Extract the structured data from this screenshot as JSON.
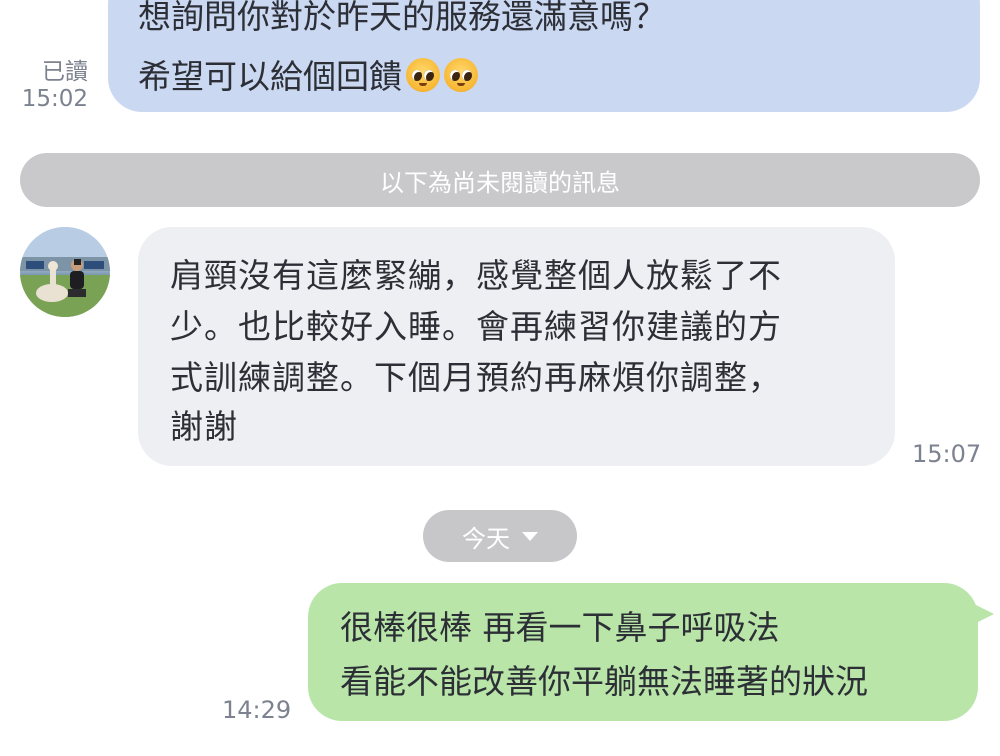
{
  "top_message": {
    "lines": [
      "想詢問你對於昨天的服務還滿意嗎？",
      "希望可以給個回饋"
    ],
    "emojis": [
      "pleading-face-emoji",
      "pleading-face-emoji"
    ],
    "read_label": "已讀",
    "time": "15:02"
  },
  "unread_divider": "以下為尚未閱讀的訊息",
  "incoming_message": {
    "lines": [
      "肩頸沒有這麼緊繃，感覺整個人放鬆了不",
      "少。也比較好入睡。會再練習你建議的方",
      "式訓練調整。下個月預約再麻煩你調整，",
      "謝謝"
    ],
    "time": "15:07"
  },
  "date_chip": {
    "label": "今天",
    "icon": "caret-down-icon"
  },
  "bottom_message": {
    "lines": [
      "很棒很棒 再看一下鼻子呼吸法",
      "看能不能改善你平躺無法睡著的狀況"
    ],
    "time": "14:29"
  },
  "colors": {
    "sent_bubble_blue": "#cbd8f2",
    "received_bubble": "#eeeff2",
    "sent_bubble_green": "#b9e6a8",
    "divider": "#c9c9cc"
  }
}
